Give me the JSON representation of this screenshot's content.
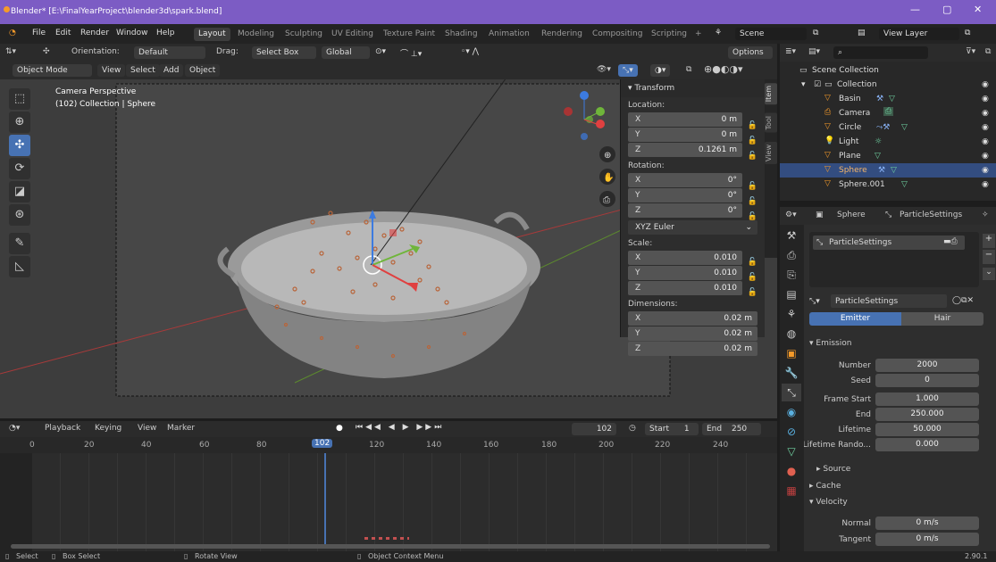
{
  "window": {
    "title": "Blender* [E:\\FinalYearProject\\blender3d\\spark.blend]",
    "controls": [
      "—",
      "▢",
      "✕"
    ]
  },
  "menubar": {
    "items": [
      "File",
      "Edit",
      "Render",
      "Window",
      "Help"
    ],
    "workspaces": [
      "Layout",
      "Modeling",
      "Sculpting",
      "UV Editing",
      "Texture Paint",
      "Shading",
      "Animation",
      "Rendering",
      "Compositing",
      "Scripting",
      "+"
    ],
    "scene": "Scene",
    "view_layer": "View Layer"
  },
  "viewport_header": {
    "orientation_label": "Orientation:",
    "orientation_value": "Default",
    "drag_label": "Drag:",
    "drag_value": "Select Box",
    "transform_value": "Global",
    "options": "Options",
    "mode": "Object Mode",
    "view": "View",
    "select": "Select",
    "add": "Add",
    "object": "Object"
  },
  "viewport": {
    "camera_label": "Camera Perspective",
    "collection_label": "(102) Collection | Sphere"
  },
  "npanel": {
    "title": "Transform",
    "location_label": "Location:",
    "location": [
      {
        "axis": "X",
        "value": "0 m"
      },
      {
        "axis": "Y",
        "value": "0 m"
      },
      {
        "axis": "Z",
        "value": "0.1261 m"
      }
    ],
    "rotation_label": "Rotation:",
    "rotation": [
      {
        "axis": "X",
        "value": "0°"
      },
      {
        "axis": "Y",
        "value": "0°"
      },
      {
        "axis": "Z",
        "value": "0°"
      }
    ],
    "rotation_mode": "XYZ Euler",
    "scale_label": "Scale:",
    "scale": [
      {
        "axis": "X",
        "value": "0.010"
      },
      {
        "axis": "Y",
        "value": "0.010"
      },
      {
        "axis": "Z",
        "value": "0.010"
      }
    ],
    "dimensions_label": "Dimensions:",
    "dimensions": [
      {
        "axis": "X",
        "value": "0.02 m"
      },
      {
        "axis": "Y",
        "value": "0.02 m"
      },
      {
        "axis": "Z",
        "value": "0.02 m"
      }
    ],
    "tabs": [
      "Item",
      "Tool",
      "View"
    ]
  },
  "timeline": {
    "playback": "Playback",
    "keying": "Keying",
    "view": "View",
    "marker": "Marker",
    "current_frame": "102",
    "start_label": "Start",
    "start": "1",
    "end_label": "End",
    "end": "250",
    "ticks": [
      "0",
      "20",
      "40",
      "60",
      "80",
      "102",
      "120",
      "140",
      "160",
      "180",
      "200",
      "220",
      "240"
    ]
  },
  "statusbar": {
    "select": "Select",
    "box_select": "Box Select",
    "rotate_view": "Rotate View",
    "context_menu": "Object Context Menu",
    "version": "2.90.1"
  },
  "outliner": {
    "scene_collection": "Scene Collection",
    "collection": "Collection",
    "items": [
      "Basin",
      "Camera",
      "Circle",
      "Light",
      "Plane",
      "Sphere",
      "Sphere.001"
    ]
  },
  "properties": {
    "object_name": "Sphere",
    "particle_settings": "ParticleSettings",
    "list_item": "ParticleSettings",
    "datablock": "ParticleSettings",
    "emitter": "Emitter",
    "hair": "Hair",
    "emission_label": "Emission",
    "fields": [
      {
        "label": "Number",
        "value": "2000"
      },
      {
        "label": "Seed",
        "value": "0"
      },
      {
        "label": "Frame Start",
        "value": "1.000"
      },
      {
        "label": "End",
        "value": "250.000"
      },
      {
        "label": "Lifetime",
        "value": "50.000"
      },
      {
        "label": "Lifetime Rando...",
        "value": "0.000"
      }
    ],
    "source_label": "Source",
    "cache_label": "Cache",
    "velocity_label": "Velocity",
    "velocity_fields": [
      {
        "label": "Normal",
        "value": "0 m/s"
      },
      {
        "label": "Tangent",
        "value": "0 m/s"
      }
    ]
  },
  "colors": {
    "titlebar": "#7c5cc4",
    "accent_blue": "#4772b3",
    "x_axis": "#e04040",
    "y_axis": "#6fb53a",
    "z_axis": "#3c7be0"
  }
}
